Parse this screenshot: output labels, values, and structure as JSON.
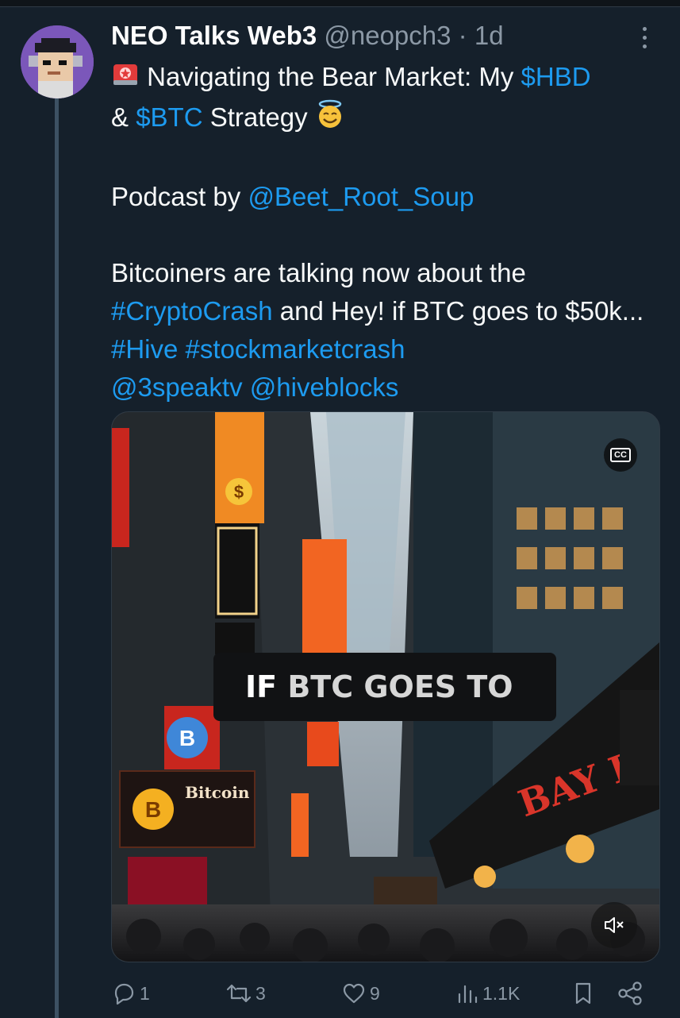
{
  "author": {
    "display_name": "NEO Talks Web3",
    "handle": "@neopch3",
    "separator": "·",
    "time": "1d"
  },
  "tweet": {
    "line1_text": "Navigating the Bear Market: My ",
    "cashtag_hbd": "$HBD",
    "amp": "& ",
    "cashtag_btc": "$BTC",
    "strategy": " Strategy ",
    "podcast_by": "Podcast by ",
    "mention_beet": "@Beet_Root_Soup",
    "para3_a": "Bitcoiners are talking now about the ",
    "hashtag_cryptocrash": "#CryptoCrash",
    "para3_b": " and Hey! if BTC goes to $50k... ",
    "hashtag_hive": "#Hive",
    "hashtag_stockmarketcrash": "#stockmarketcrash",
    "mention_3speak": "@3speaktv",
    "mention_hiveblocks": "@hiveblocks",
    "emoji_start": "rotating-light-icon",
    "emoji_end": "smiling-face-with-halo-icon"
  },
  "media": {
    "caption_white": "IF ",
    "caption_gray": "BTC GOES TO",
    "cc_label": "CC",
    "sign_bitcoin": "Bitcoin",
    "sign_b": "B",
    "sign_dollar": "$",
    "street_sign": "BAY BY"
  },
  "actions": {
    "replies": "1",
    "reposts": "3",
    "likes": "9",
    "views": "1.1K"
  },
  "colors": {
    "background": "#15202b",
    "link": "#1d9bf0",
    "muted": "#8b98a5"
  }
}
